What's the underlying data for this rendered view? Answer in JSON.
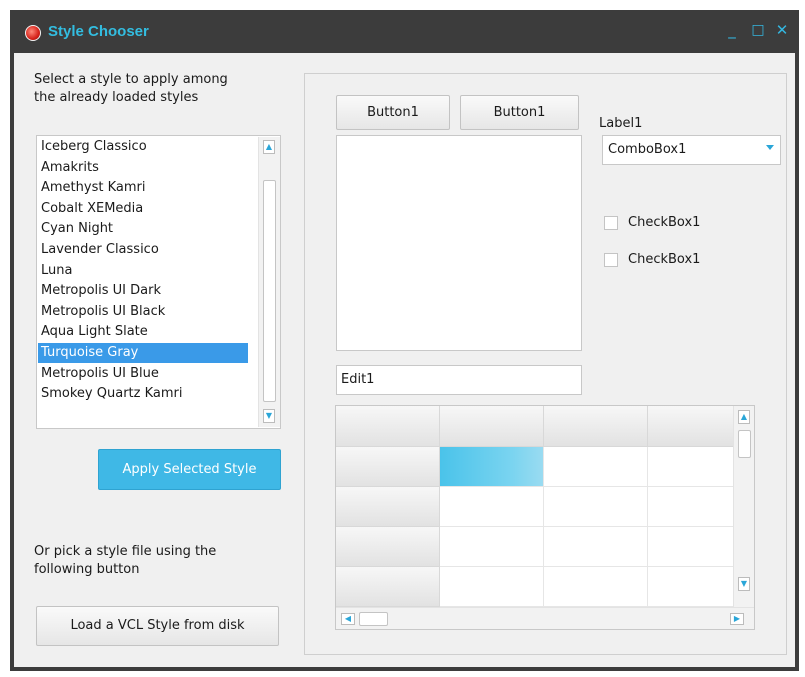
{
  "window": {
    "title": "Style Chooser",
    "minimize_glyph": "_",
    "maximize_glyph": "□",
    "close_glyph": "✕",
    "accent_color": "#33bde0"
  },
  "left": {
    "instructions": [
      "Select a style to apply among",
      "the already loaded styles"
    ],
    "styles": [
      "Iceberg Classico",
      "Amakrits",
      "Amethyst Kamri",
      "Cobalt XEMedia",
      "Cyan Night",
      "Lavender Classico",
      "Luna",
      "Metropolis UI Dark",
      "Metropolis UI Black",
      "Aqua Light Slate",
      "Turquoise Gray",
      "Metropolis UI Blue",
      "Smokey Quartz Kamri"
    ],
    "selected_index": 10,
    "apply_button": "Apply Selected Style",
    "file_instructions": [
      "Or pick a style file using the",
      "following button"
    ],
    "load_button": "Load a VCL Style from disk"
  },
  "preview": {
    "button1": "Button1",
    "button2": "Button1",
    "label": "Label1",
    "combo_value": "ComboBox1",
    "checkbox1": "CheckBox1",
    "checkbox2": "CheckBox1",
    "edit_value": "Edit1",
    "grid": {
      "rows": 5,
      "cols": 4,
      "selected_row": 1,
      "selected_col": 1
    }
  },
  "colors": {
    "selection": "#3a9ae8",
    "primary_button": "#3fb8e6",
    "grid_selection": "#4ac3ea",
    "frame": "#3c3c3c"
  }
}
